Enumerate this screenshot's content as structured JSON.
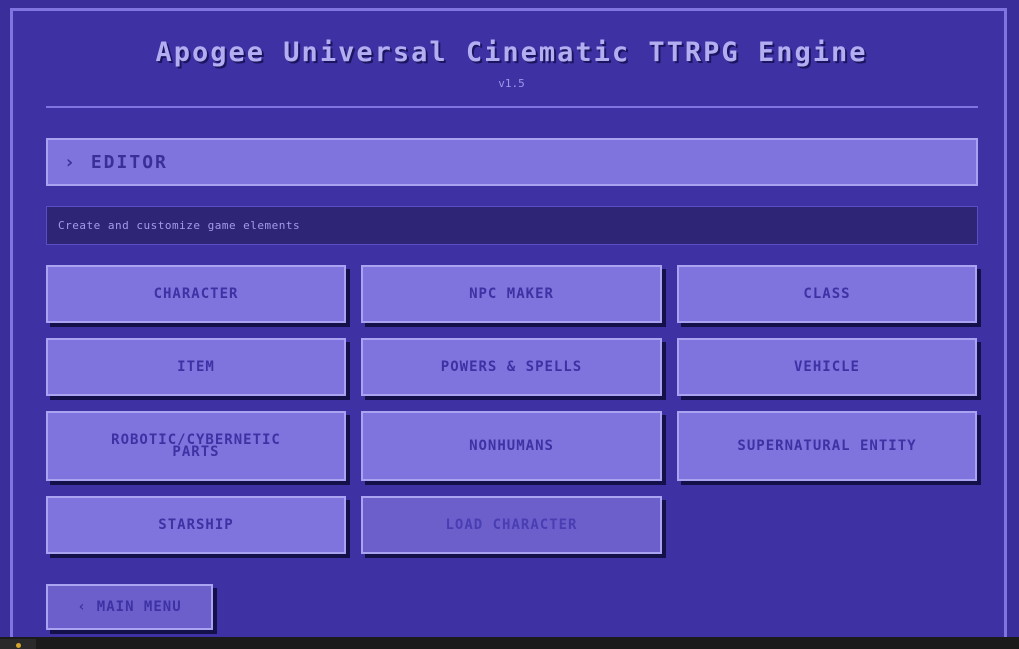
{
  "app": {
    "title": "Apogee Universal Cinematic TTRPG Engine",
    "version": "v1.5"
  },
  "section": {
    "title": "EDITOR",
    "description": "Create and customize game elements"
  },
  "buttons": [
    {
      "label": "CHARACTER"
    },
    {
      "label": "NPC MAKER"
    },
    {
      "label": "CLASS"
    },
    {
      "label": "ITEM"
    },
    {
      "label": "POWERS & SPELLS"
    },
    {
      "label": "VEHICLE"
    },
    {
      "label": "ROBOTIC/CYBERNETIC"
    },
    {
      "label": "PARTS"
    },
    {
      "label": "NONHUMANS"
    },
    {
      "label": "SUPERNATURAL ENTITY"
    },
    {
      "label": "STARSHIP"
    },
    {
      "label": "LOAD CHARACTER"
    }
  ],
  "nav": {
    "main_menu_label": "MAIN MENU"
  },
  "icons": {
    "expand": "chevron-right-icon",
    "back": "chevron-left-icon"
  },
  "colors": {
    "background": "#3d31a4",
    "button": "#7f74dd",
    "button_border": "#aaa3f1",
    "text_dark": "#3d31a4",
    "title_text": "#b3adf2"
  }
}
